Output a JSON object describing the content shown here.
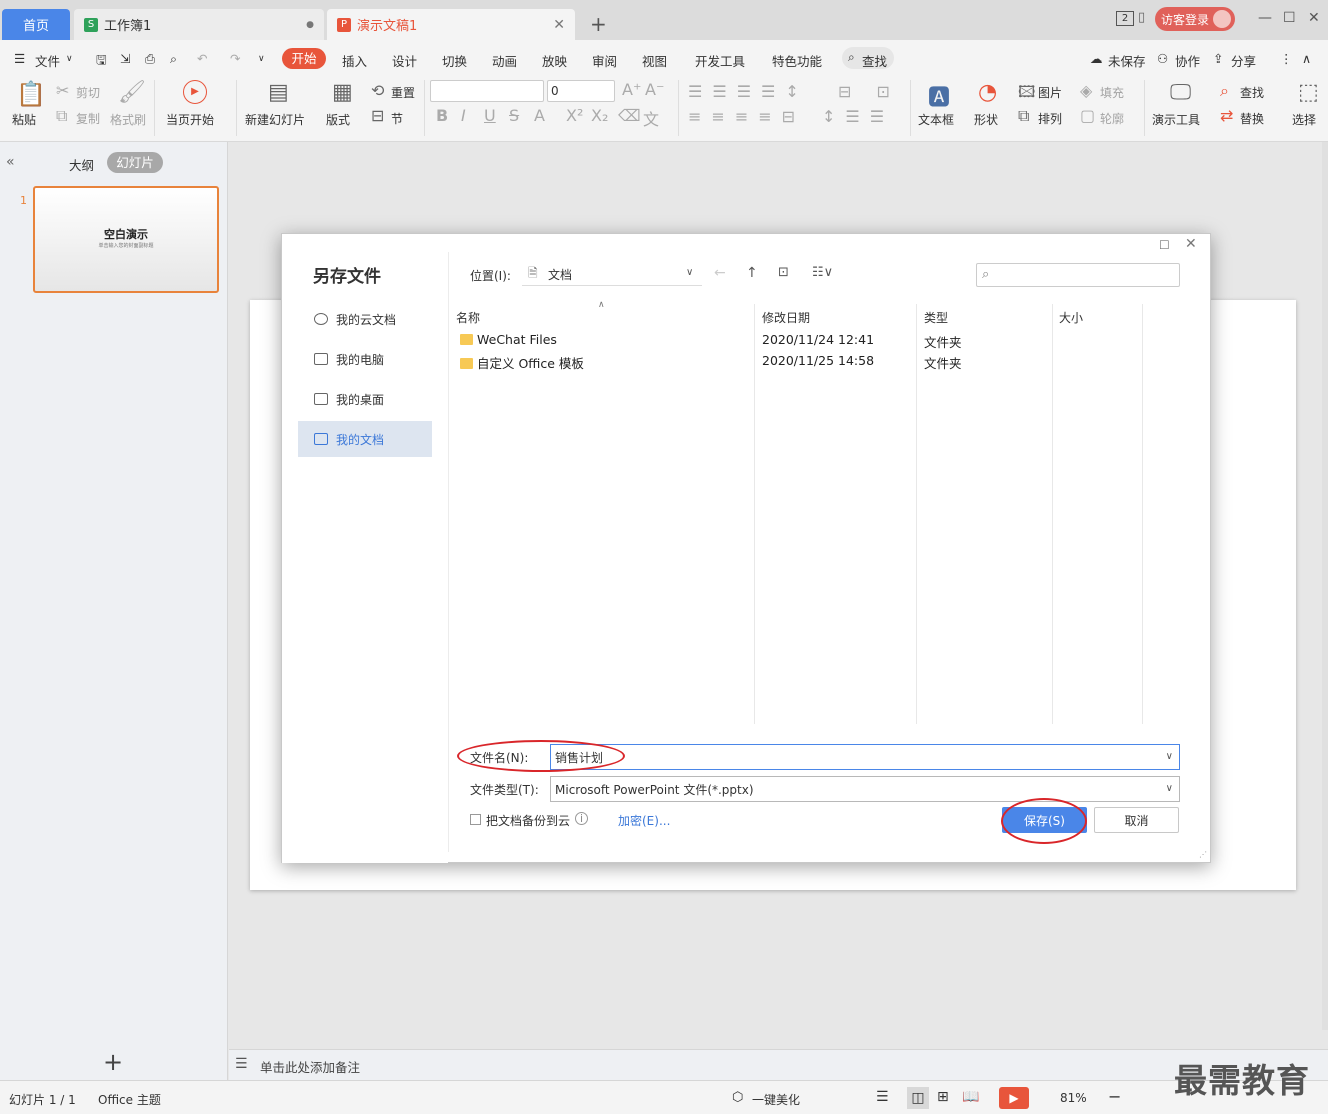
{
  "tabs": {
    "home": "首页",
    "sheet": "工作簿1",
    "ppt": "演示文稿1",
    "new": "+"
  },
  "window": {
    "badge": "2",
    "login": "访客登录"
  },
  "menu": {
    "file": "文件",
    "items": [
      "开始",
      "插入",
      "设计",
      "切换",
      "动画",
      "放映",
      "审阅",
      "视图",
      "开发工具",
      "特色功能"
    ],
    "search": "查找",
    "unsaved": "未保存",
    "collab": "协作",
    "share": "分享"
  },
  "ribbon": {
    "paste": "粘贴",
    "cut": "剪切",
    "copy": "复制",
    "format_painter": "格式刷",
    "from_current": "当页开始",
    "new_slide": "新建幻灯片",
    "layout": "版式",
    "reset": "重置",
    "section": "节",
    "font_size": "0",
    "textbox": "文本框",
    "shape": "形状",
    "picture": "图片",
    "fill": "填充",
    "arrange": "排列",
    "outline": "轮廓",
    "present_tools": "演示工具",
    "find": "查找",
    "replace": "替换",
    "select": "选择"
  },
  "leftpanel": {
    "outline_tab": "大纲",
    "slides_tab": "幻灯片",
    "slide_number": "1",
    "slide_title": "空白演示",
    "slide_subtitle": "单击输入您的封面副标题",
    "add": "+"
  },
  "dialog": {
    "title": "另存文件",
    "nav": [
      "我的云文档",
      "我的电脑",
      "我的桌面",
      "我的文档"
    ],
    "location_label": "位置(I):",
    "location_value": "文档",
    "columns": {
      "name": "名称",
      "date": "修改日期",
      "type": "类型",
      "size": "大小"
    },
    "files": [
      {
        "name": "WeChat Files",
        "date": "2020/11/24 12:41",
        "type": "文件夹"
      },
      {
        "name": "自定义 Office 模板",
        "date": "2020/11/25 14:58",
        "type": "文件夹"
      }
    ],
    "filename_label": "文件名(N):",
    "filename_value": "销售计划",
    "filetype_label": "文件类型(T):",
    "filetype_value": "Microsoft PowerPoint 文件(*.pptx)",
    "backup_label": "把文档备份到云",
    "encrypt_label": "加密(E)...",
    "save_label": "保存(S)",
    "cancel_label": "取消"
  },
  "notes": {
    "placeholder": "单击此处添加备注"
  },
  "status": {
    "slide": "幻灯片 1 / 1",
    "theme": "Office 主题",
    "beautify": "一键美化",
    "zoom": "81%"
  },
  "watermark": "最需教育",
  "colors": {
    "accent": "#e8553b",
    "blue": "#4a86e8",
    "annotation": "#d9262a"
  }
}
